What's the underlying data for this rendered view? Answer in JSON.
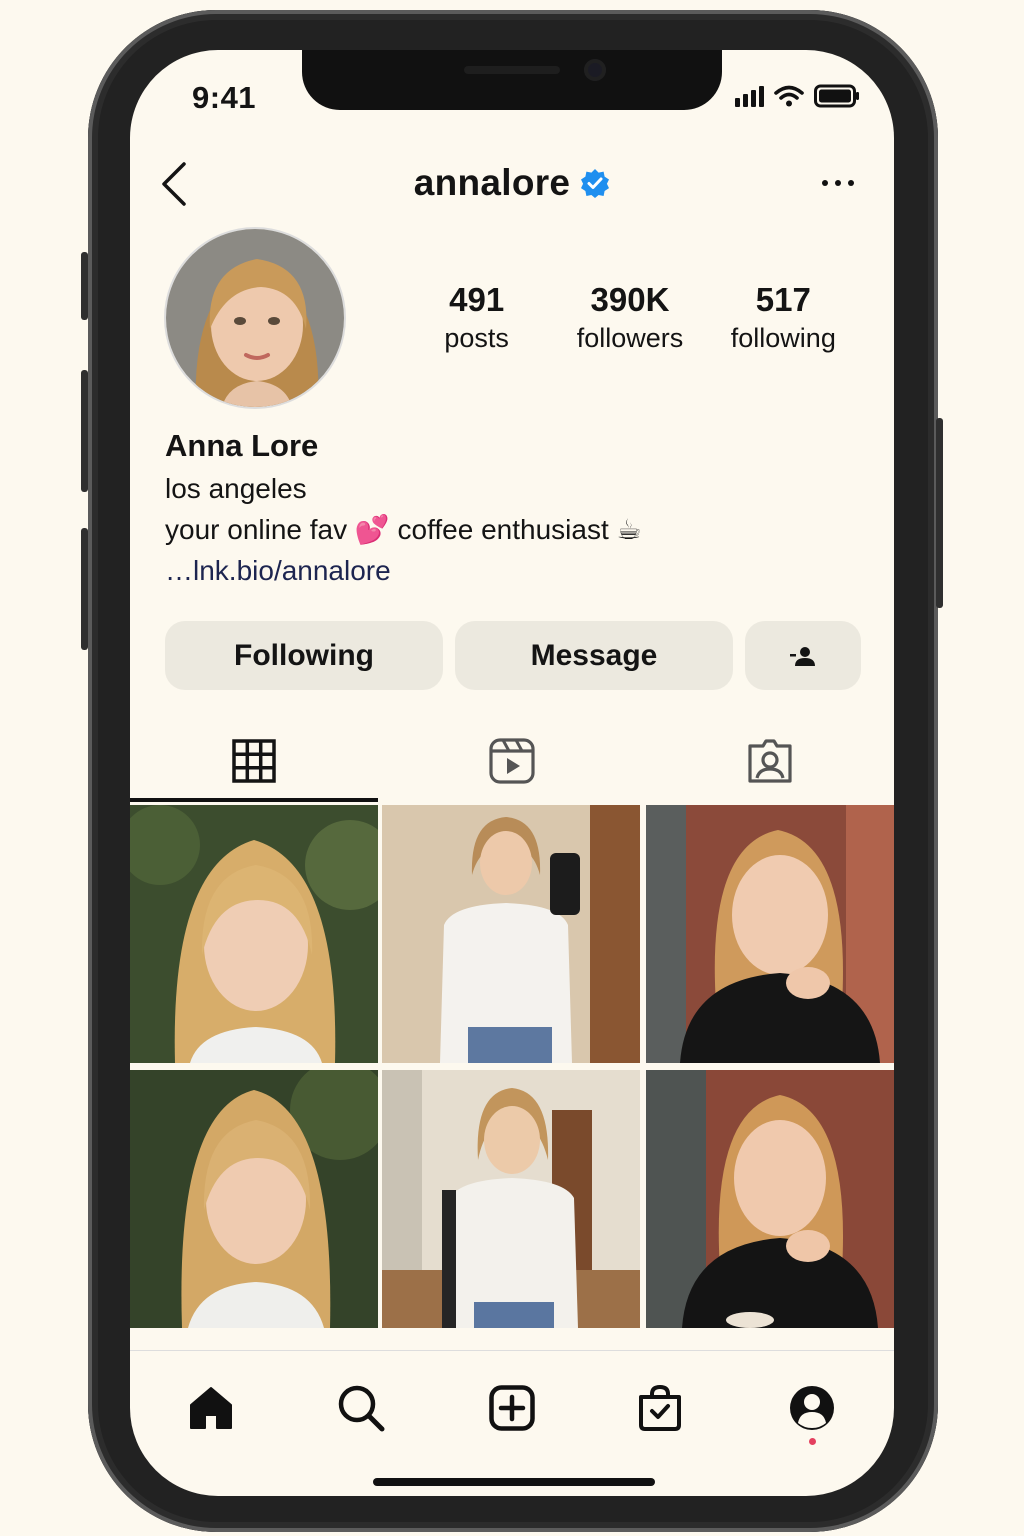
{
  "status_bar": {
    "time": "9:41"
  },
  "header": {
    "username": "annalore",
    "verified": true,
    "back_icon": "chevron-left-icon",
    "more_icon": "more-horizontal-icon"
  },
  "profile": {
    "stats": [
      {
        "value": "491",
        "label": "posts"
      },
      {
        "value": "390K",
        "label": "followers"
      },
      {
        "value": "517",
        "label": "following"
      }
    ],
    "display_name": "Anna Lore",
    "bio_lines": [
      "los angeles",
      "your online fav 💕  coffee enthusiast ☕"
    ],
    "link": "…lnk.bio/annalore"
  },
  "actions": {
    "following_label": "Following",
    "message_label": "Message",
    "suggest_icon": "add-person-icon"
  },
  "tabs": [
    {
      "icon": "grid-icon",
      "active": true
    },
    {
      "icon": "reels-icon",
      "active": false
    },
    {
      "icon": "tagged-icon",
      "active": false
    }
  ],
  "nav": [
    "home-icon",
    "search-icon",
    "create-icon",
    "shop-icon",
    "profile-icon"
  ],
  "colors": {
    "background": "#fdf9ef",
    "button": "#ece9df",
    "verified": "#1f8fef",
    "notification": "#e4405f"
  }
}
